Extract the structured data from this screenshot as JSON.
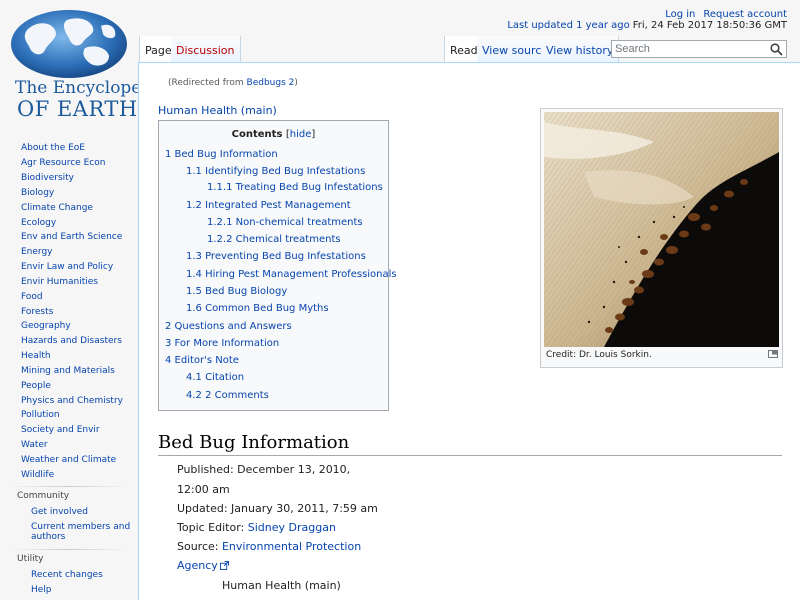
{
  "logo": {
    "line1": "The Encyclopedia",
    "line2": "OF EARTH"
  },
  "personal": {
    "login": "Log in",
    "request": "Request account"
  },
  "last_updated": {
    "link": "Last updated 1 year ago",
    "date": "Fri, 24 Feb 2017 18:50:36 GMT"
  },
  "tabs": {
    "page": "Page",
    "discussion": "Discussion",
    "read": "Read",
    "view_source": "View source",
    "view_history": "View history"
  },
  "search": {
    "placeholder": "Search"
  },
  "sidebar": {
    "items": [
      "About the EoE",
      "Agr Resource Econ",
      "Biodiversity",
      "Biology",
      "Climate Change",
      "Ecology",
      "Env and Earth Science",
      "Energy",
      "Envir Law and Policy",
      "Envir Humanities",
      "Food",
      "Forests",
      "Geography",
      "Hazards and Disasters",
      "Health",
      "Mining and Materials",
      "People",
      "Physics and Chemistry",
      "Pollution",
      "Society and Envir",
      "Water",
      "Weather and Climate",
      "Wildlife"
    ],
    "community": {
      "title": "Community",
      "get_involved": "Get involved",
      "current_members": "Current members and authors"
    },
    "utilities": {
      "title": "Utility",
      "recent_changes": "Recent changes",
      "help": "Help"
    }
  },
  "content": {
    "redirect_prefix": "(Redirected from ",
    "redirect_link": "Bedbugs 2",
    "redirect_suffix": ")",
    "hh_main": "Human Health (main)",
    "toc": {
      "title": "Contents",
      "hide_open": "[",
      "hide": "hide",
      "hide_close": "]",
      "items": [
        "1 Bed Bug Information",
        "1.1 Identifying Bed Bug Infestations",
        "1.1.1 Treating Bed Bug Infestations",
        "1.2 Integrated Pest Management",
        "1.2.1 Non-chemical treatments",
        "1.2.2 Chemical treatments",
        "1.3 Preventing Bed Bug Infestations",
        "1.4 Hiring Pest Management Professionals",
        "1.5 Bed Bug Biology",
        "1.6 Common Bed Bug Myths",
        "2 Questions and Answers",
        "3 For More Information",
        "4 Editor's Note",
        "4.1 Citation",
        "4.2 2 Comments"
      ]
    },
    "thumb_caption": "Credit: Dr. Louis Sorkin.",
    "heading": "Bed Bug Information",
    "published_1": "Published: December 13, 2010,",
    "published_2": "12:00 am",
    "updated": "Updated: January 30, 2011, 7:59 am",
    "topic_editor_label": "Topic Editor: ",
    "topic_editor": "Sidney Draggan",
    "source_label": "Source: ",
    "source_1": "Environmental Protection",
    "source_2": "Agency",
    "hh_main_2": "Human Health (main)"
  },
  "colors": {
    "link": "#0645ad",
    "logo_blue": "#1d5a9c",
    "border": "#a7d7f9"
  }
}
